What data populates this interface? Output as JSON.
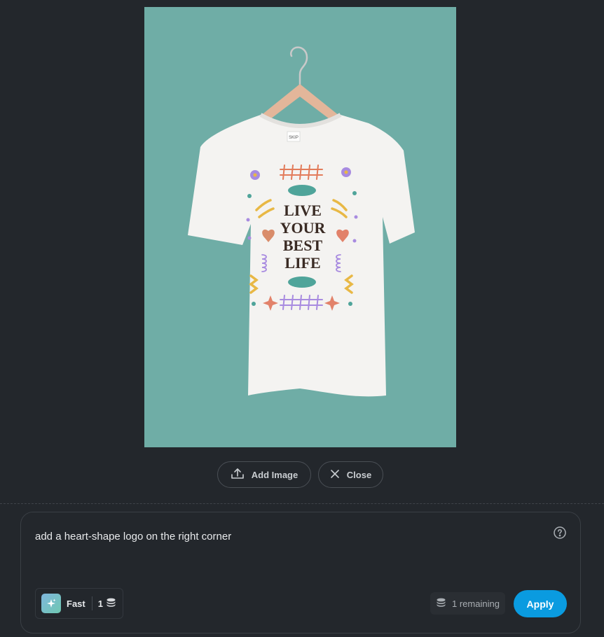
{
  "preview": {
    "design_text": [
      "LIVE",
      "YOUR",
      "BEST",
      "LIFE"
    ],
    "tag_text": "SKIP",
    "background_color": "#6fada6"
  },
  "actions": {
    "add_image_label": "Add Image",
    "close_label": "Close"
  },
  "prompt_panel": {
    "prompt_text": "add a heart-shape logo on the right corner",
    "model": {
      "name": "Fast",
      "cost": "1"
    },
    "remaining_text": "1 remaining",
    "apply_label": "Apply"
  },
  "colors": {
    "accent": "#0a9be0",
    "background": "#23272c"
  }
}
